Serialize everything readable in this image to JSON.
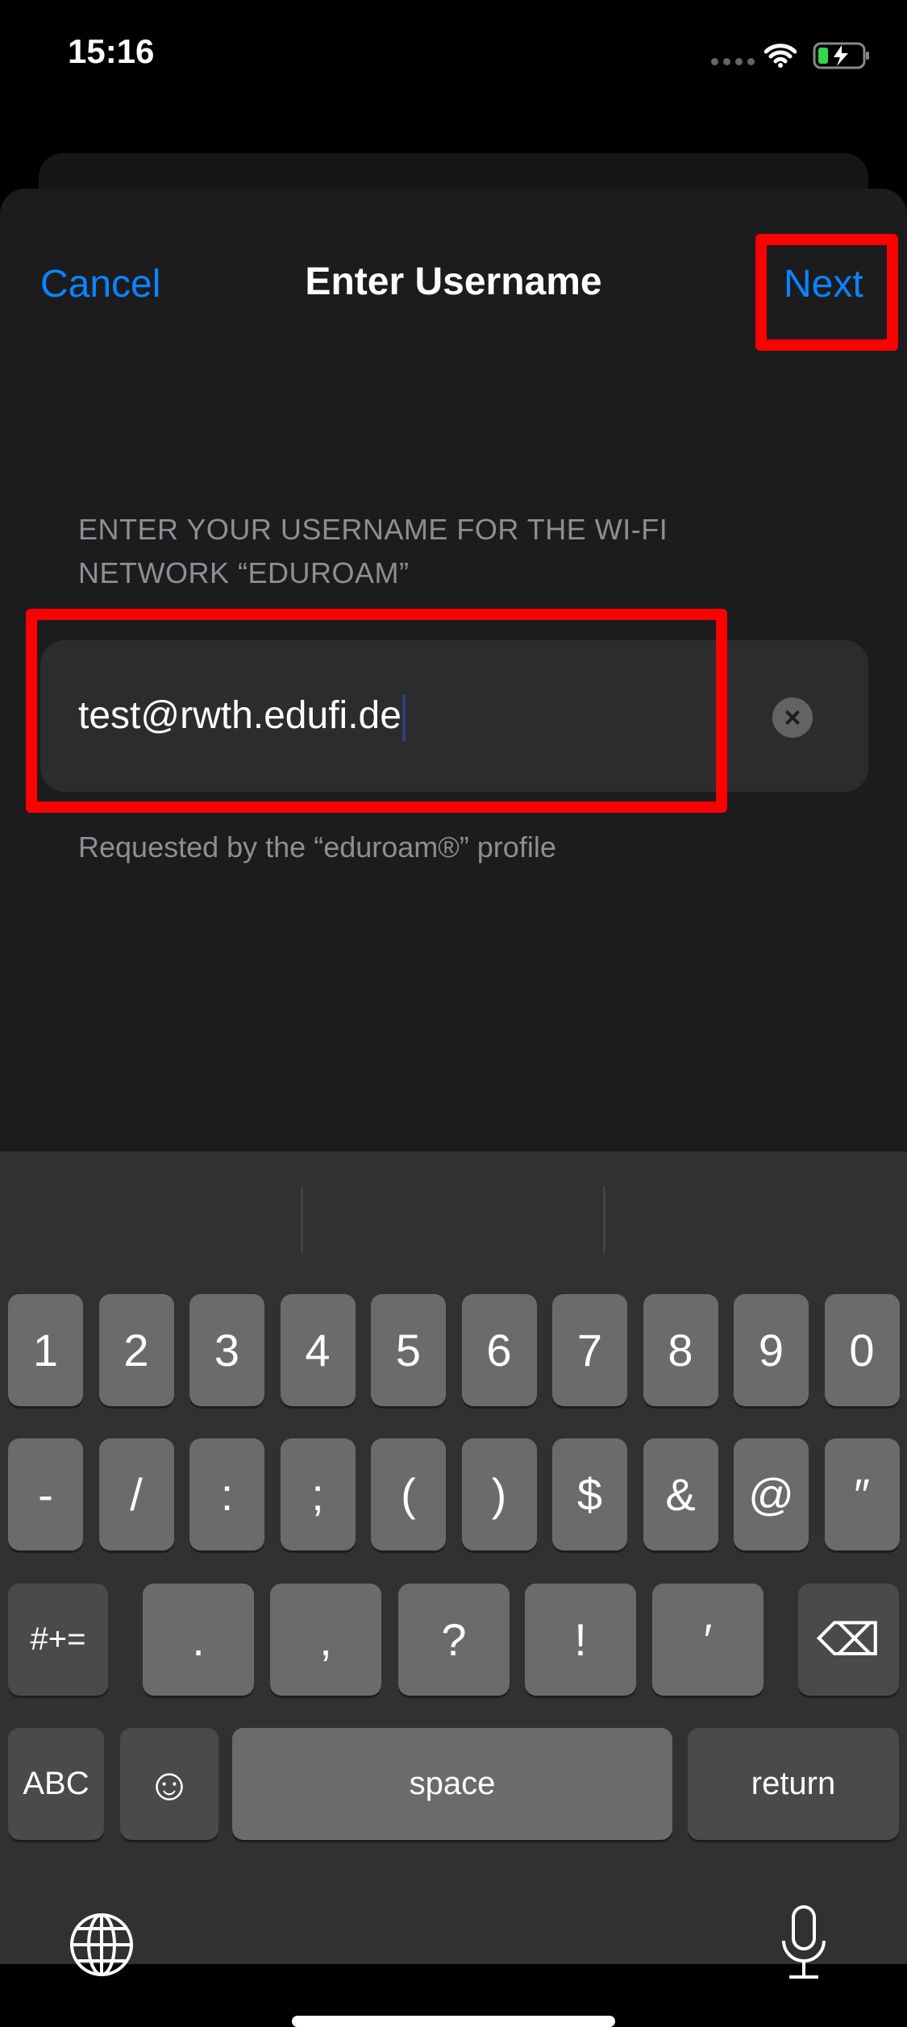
{
  "status_bar": {
    "time": "15:16",
    "wifi": "wifi-icon",
    "battery": "battery-charging-icon"
  },
  "nav": {
    "cancel": "Cancel",
    "title": "Enter Username",
    "next": "Next"
  },
  "form": {
    "label": "ENTER YOUR USERNAME FOR THE WI-FI NETWORK “EDUROAM”",
    "value": "test@rwth.edufi.de",
    "clear": "×",
    "footer": "Requested by the “eduroam®” profile"
  },
  "highlight_color": "#ff0000",
  "accent_color": "#0a84ff",
  "keyboard": {
    "row1": [
      "1",
      "2",
      "3",
      "4",
      "5",
      "6",
      "7",
      "8",
      "9",
      "0"
    ],
    "row2": [
      "-",
      "/",
      ":",
      ";",
      "(",
      ")",
      "$",
      "&",
      "@",
      "″"
    ],
    "row3": {
      "shift": "#+=",
      "keys": [
        ".",
        ",",
        "?",
        "!",
        "′"
      ],
      "delete": "⌫"
    },
    "row4": {
      "abc": "ABC",
      "emoji": "☺",
      "space": "space",
      "return": "return"
    },
    "globe": "🌐",
    "mic": "🎙"
  }
}
